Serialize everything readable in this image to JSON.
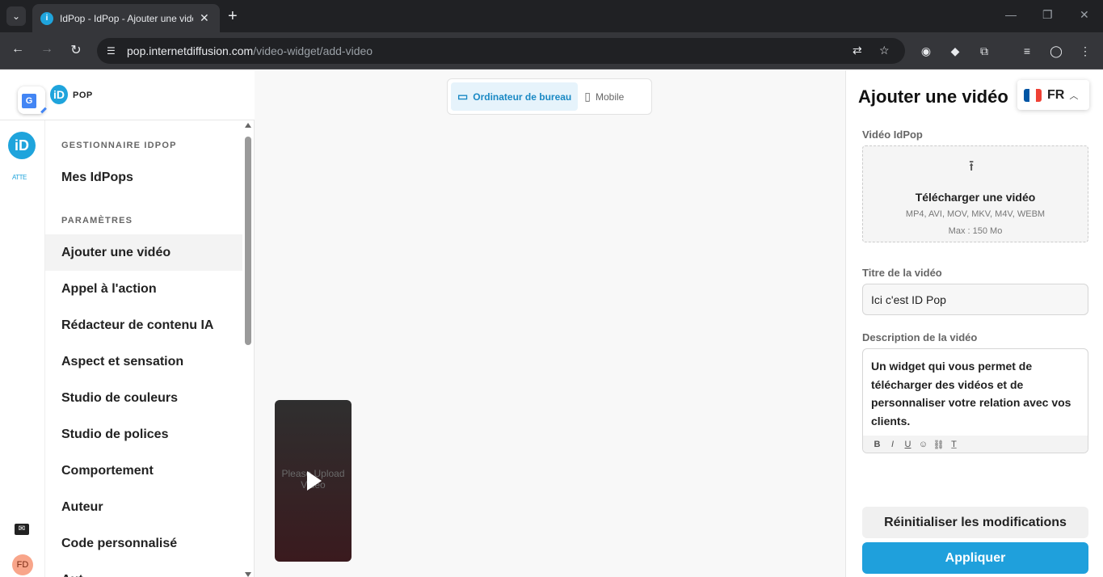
{
  "browser": {
    "tab_title": "IdPop - IdPop - Ajouter une vidé",
    "url_host": "pop.internetdiffusion.com",
    "url_path": "/video-widget/add-video"
  },
  "brand": {
    "logo_letter": "iD",
    "name": "POP"
  },
  "rail": {
    "user_initials": "FD",
    "small_label": "ATTE"
  },
  "sidebar": {
    "section_manager": "GESTIONNAIRE IDPOP",
    "my_idpops": "Mes IdPops",
    "section_params": "PARAMÈTRES",
    "items": [
      {
        "label": "Ajouter une vidéo"
      },
      {
        "label": "Appel à l'action"
      },
      {
        "label": "Rédacteur de contenu IA"
      },
      {
        "label": "Aspect et sensation"
      },
      {
        "label": "Studio de couleurs"
      },
      {
        "label": "Studio de polices"
      },
      {
        "label": "Comportement"
      },
      {
        "label": "Auteur"
      },
      {
        "label": "Code personnalisé"
      },
      {
        "label": "Aut"
      }
    ]
  },
  "canvas": {
    "desktop_label": "Ordinateur de bureau",
    "mobile_label": "Mobile",
    "video_placeholder": "Please Upload Video"
  },
  "panel": {
    "title": "Ajouter une vidéo",
    "language": "FR",
    "video_label": "Vidéo IdPop",
    "upload_title": "Télécharger une vidéo",
    "upload_formats": "MP4, AVI, MOV, MKV, M4V, WEBM",
    "upload_max": "Max : 150 Mo",
    "title_label": "Titre de la vidéo",
    "title_value": "Ici c'est ID Pop",
    "desc_label": "Description de la vidéo",
    "desc_value": "Un widget qui vous permet de télécharger des vidéos et de personnaliser votre relation avec vos clients.",
    "reset_label": "Réinitialiser les modifications",
    "apply_label": "Appliquer"
  },
  "colors": {
    "accent": "#1fa0dc",
    "flag_blue": "#0055a4",
    "flag_white": "#ffffff",
    "flag_red": "#ef4135"
  }
}
